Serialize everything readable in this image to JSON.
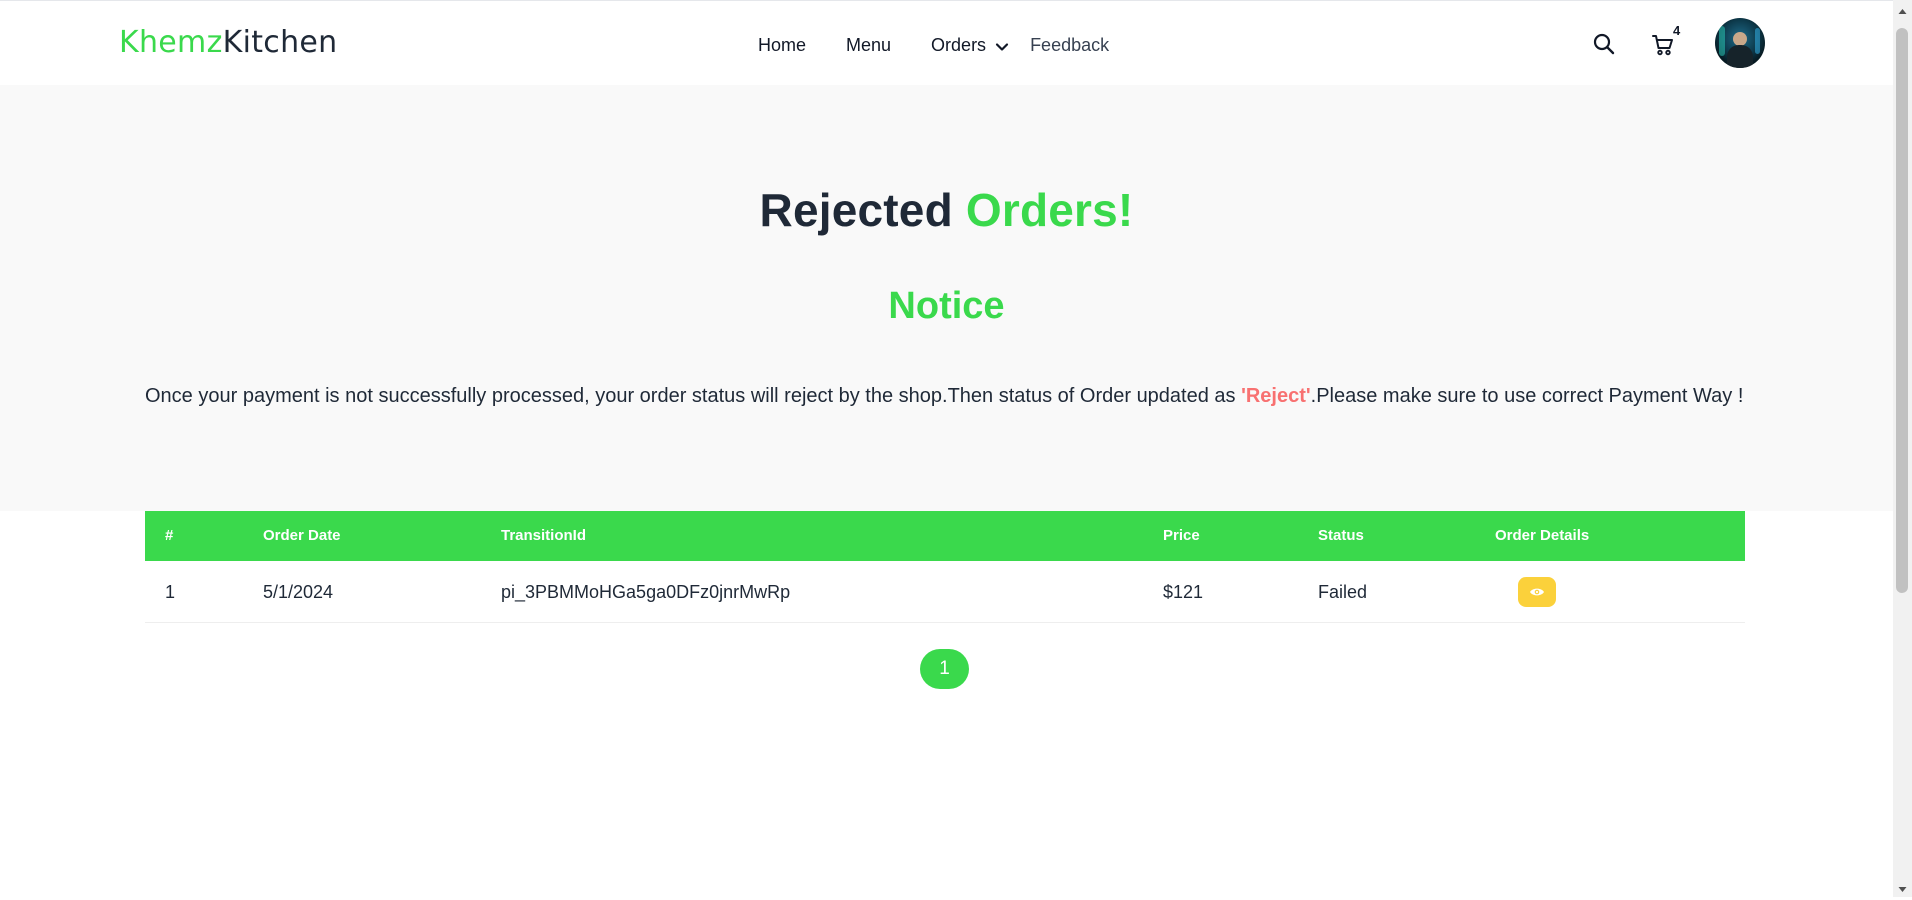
{
  "brand": {
    "part1": "Khemz",
    "part2": "Kitchen"
  },
  "nav": {
    "home": "Home",
    "menu": "Menu",
    "orders": "Orders",
    "feedback": "Feedback"
  },
  "header": {
    "cart_count": "4"
  },
  "page": {
    "title_part1": "Rejected",
    "title_part2": "Orders!",
    "notice_heading": "Notice",
    "notice_text_before": "Once your payment is not successfully processed, your order status will reject by the shop.Then status of Order updated as ",
    "notice_highlight": "'Reject'",
    "notice_text_after": ".Please make sure to use correct Payment Way !"
  },
  "table": {
    "headers": [
      "#",
      "Order Date",
      "TransitionId",
      "Price",
      "Status",
      "Order Details"
    ],
    "rows": [
      {
        "num": "1",
        "date": "5/1/2024",
        "transaction_id": "pi_3PBMMoHGa5ga0DFz0jnrMwRp",
        "price": "$121",
        "status": "Failed"
      }
    ]
  },
  "pagination": {
    "current": "1"
  },
  "colors": {
    "accent_green": "#3ad94c",
    "reject_red": "#f87171",
    "view_yellow": "#fbd13b",
    "text_dark": "#1f2937"
  },
  "icons": {
    "search": "search-icon",
    "cart": "cart-icon",
    "dropdown": "chevron-down-icon",
    "view": "eye-icon"
  }
}
